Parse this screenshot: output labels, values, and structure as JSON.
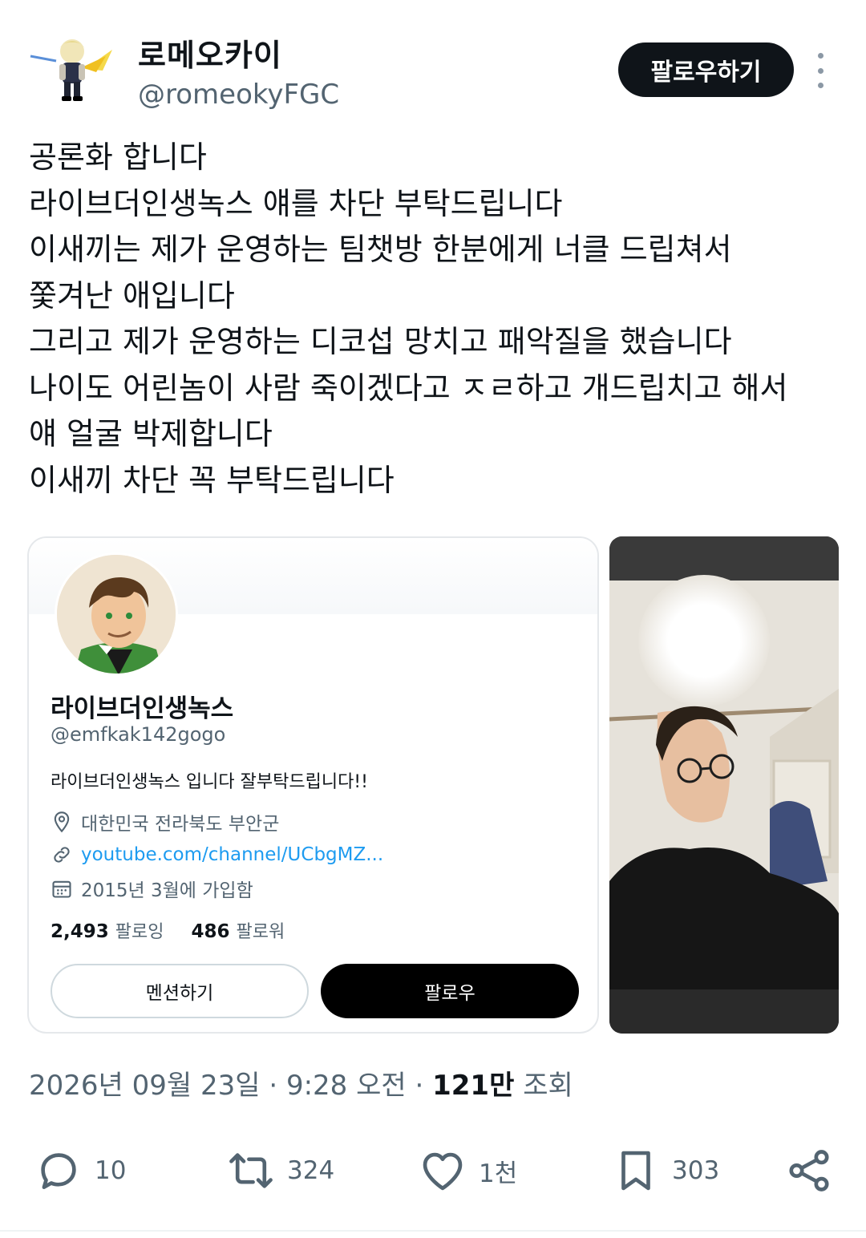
{
  "author": {
    "display_name": "로메오카이",
    "handle": "@romeokyFGC",
    "follow_label": "팔로우하기",
    "more_icon": "more-vertical-icon"
  },
  "tweet": {
    "lines": [
      "공론화 합니다",
      "라이브더인생녹스 얘를 차단 부탁드립니다",
      "이새끼는 제가 운영하는 팀챗방 한분에게 너클 드립쳐서",
      "쫓겨난 애입니다",
      "그리고 제가 운영하는 디코섭 망치고 패악질을 했습니다",
      "나이도 어린놈이 사람 죽이겠다고 ㅈㄹ하고 개드립치고 해서",
      "얘 얼굴 박제합니다",
      "이새끼 차단 꼭 부탁드립니다"
    ]
  },
  "profile_card": {
    "name": "라이브더인생녹스",
    "handle": "@emfkak142gogo",
    "bio": "라이브더인생녹스 입니다 잘부탁드립니다!!",
    "location": "대한민국 전라북도 부안군",
    "link": "youtube.com/channel/UCbgMZ...",
    "joined": "2015년 3월에 가입함",
    "following_count": "2,493",
    "following_label": "팔로잉",
    "followers_count": "486",
    "followers_label": "팔로워",
    "mention_label": "멘션하기",
    "follow_label": "팔로우"
  },
  "meta": {
    "date": "2026년 09월 23일",
    "time": "9:28 오전",
    "views_count": "121만",
    "views_label": "조회",
    "separator": " · "
  },
  "actions": {
    "reply_count": "10",
    "retweet_count": "324",
    "like_count": "1천",
    "bookmark_count": "303"
  },
  "colors": {
    "text": "#0f1419",
    "secondary": "#536471",
    "link": "#1d9bf0",
    "button_dark": "#0f1419",
    "border": "#e5e8eb"
  }
}
